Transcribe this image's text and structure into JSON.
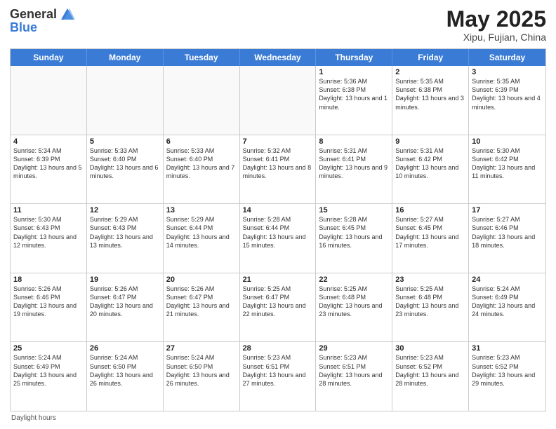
{
  "header": {
    "logo_general": "General",
    "logo_blue": "Blue",
    "month_title": "May 2025",
    "subtitle": "Xipu, Fujian, China"
  },
  "weekdays": [
    "Sunday",
    "Monday",
    "Tuesday",
    "Wednesday",
    "Thursday",
    "Friday",
    "Saturday"
  ],
  "rows": [
    [
      {
        "day": "",
        "info": "",
        "empty": true
      },
      {
        "day": "",
        "info": "",
        "empty": true
      },
      {
        "day": "",
        "info": "",
        "empty": true
      },
      {
        "day": "",
        "info": "",
        "empty": true
      },
      {
        "day": "1",
        "info": "Sunrise: 5:36 AM\nSunset: 6:38 PM\nDaylight: 13 hours and 1 minute."
      },
      {
        "day": "2",
        "info": "Sunrise: 5:35 AM\nSunset: 6:38 PM\nDaylight: 13 hours and 3 minutes."
      },
      {
        "day": "3",
        "info": "Sunrise: 5:35 AM\nSunset: 6:39 PM\nDaylight: 13 hours and 4 minutes."
      }
    ],
    [
      {
        "day": "4",
        "info": "Sunrise: 5:34 AM\nSunset: 6:39 PM\nDaylight: 13 hours and 5 minutes."
      },
      {
        "day": "5",
        "info": "Sunrise: 5:33 AM\nSunset: 6:40 PM\nDaylight: 13 hours and 6 minutes."
      },
      {
        "day": "6",
        "info": "Sunrise: 5:33 AM\nSunset: 6:40 PM\nDaylight: 13 hours and 7 minutes."
      },
      {
        "day": "7",
        "info": "Sunrise: 5:32 AM\nSunset: 6:41 PM\nDaylight: 13 hours and 8 minutes."
      },
      {
        "day": "8",
        "info": "Sunrise: 5:31 AM\nSunset: 6:41 PM\nDaylight: 13 hours and 9 minutes."
      },
      {
        "day": "9",
        "info": "Sunrise: 5:31 AM\nSunset: 6:42 PM\nDaylight: 13 hours and 10 minutes."
      },
      {
        "day": "10",
        "info": "Sunrise: 5:30 AM\nSunset: 6:42 PM\nDaylight: 13 hours and 11 minutes."
      }
    ],
    [
      {
        "day": "11",
        "info": "Sunrise: 5:30 AM\nSunset: 6:43 PM\nDaylight: 13 hours and 12 minutes."
      },
      {
        "day": "12",
        "info": "Sunrise: 5:29 AM\nSunset: 6:43 PM\nDaylight: 13 hours and 13 minutes."
      },
      {
        "day": "13",
        "info": "Sunrise: 5:29 AM\nSunset: 6:44 PM\nDaylight: 13 hours and 14 minutes."
      },
      {
        "day": "14",
        "info": "Sunrise: 5:28 AM\nSunset: 6:44 PM\nDaylight: 13 hours and 15 minutes."
      },
      {
        "day": "15",
        "info": "Sunrise: 5:28 AM\nSunset: 6:45 PM\nDaylight: 13 hours and 16 minutes."
      },
      {
        "day": "16",
        "info": "Sunrise: 5:27 AM\nSunset: 6:45 PM\nDaylight: 13 hours and 17 minutes."
      },
      {
        "day": "17",
        "info": "Sunrise: 5:27 AM\nSunset: 6:46 PM\nDaylight: 13 hours and 18 minutes."
      }
    ],
    [
      {
        "day": "18",
        "info": "Sunrise: 5:26 AM\nSunset: 6:46 PM\nDaylight: 13 hours and 19 minutes."
      },
      {
        "day": "19",
        "info": "Sunrise: 5:26 AM\nSunset: 6:47 PM\nDaylight: 13 hours and 20 minutes."
      },
      {
        "day": "20",
        "info": "Sunrise: 5:26 AM\nSunset: 6:47 PM\nDaylight: 13 hours and 21 minutes."
      },
      {
        "day": "21",
        "info": "Sunrise: 5:25 AM\nSunset: 6:47 PM\nDaylight: 13 hours and 22 minutes."
      },
      {
        "day": "22",
        "info": "Sunrise: 5:25 AM\nSunset: 6:48 PM\nDaylight: 13 hours and 23 minutes."
      },
      {
        "day": "23",
        "info": "Sunrise: 5:25 AM\nSunset: 6:48 PM\nDaylight: 13 hours and 23 minutes."
      },
      {
        "day": "24",
        "info": "Sunrise: 5:24 AM\nSunset: 6:49 PM\nDaylight: 13 hours and 24 minutes."
      }
    ],
    [
      {
        "day": "25",
        "info": "Sunrise: 5:24 AM\nSunset: 6:49 PM\nDaylight: 13 hours and 25 minutes."
      },
      {
        "day": "26",
        "info": "Sunrise: 5:24 AM\nSunset: 6:50 PM\nDaylight: 13 hours and 26 minutes."
      },
      {
        "day": "27",
        "info": "Sunrise: 5:24 AM\nSunset: 6:50 PM\nDaylight: 13 hours and 26 minutes."
      },
      {
        "day": "28",
        "info": "Sunrise: 5:23 AM\nSunset: 6:51 PM\nDaylight: 13 hours and 27 minutes."
      },
      {
        "day": "29",
        "info": "Sunrise: 5:23 AM\nSunset: 6:51 PM\nDaylight: 13 hours and 28 minutes."
      },
      {
        "day": "30",
        "info": "Sunrise: 5:23 AM\nSunset: 6:52 PM\nDaylight: 13 hours and 28 minutes."
      },
      {
        "day": "31",
        "info": "Sunrise: 5:23 AM\nSunset: 6:52 PM\nDaylight: 13 hours and 29 minutes."
      }
    ]
  ],
  "footer": "Daylight hours"
}
